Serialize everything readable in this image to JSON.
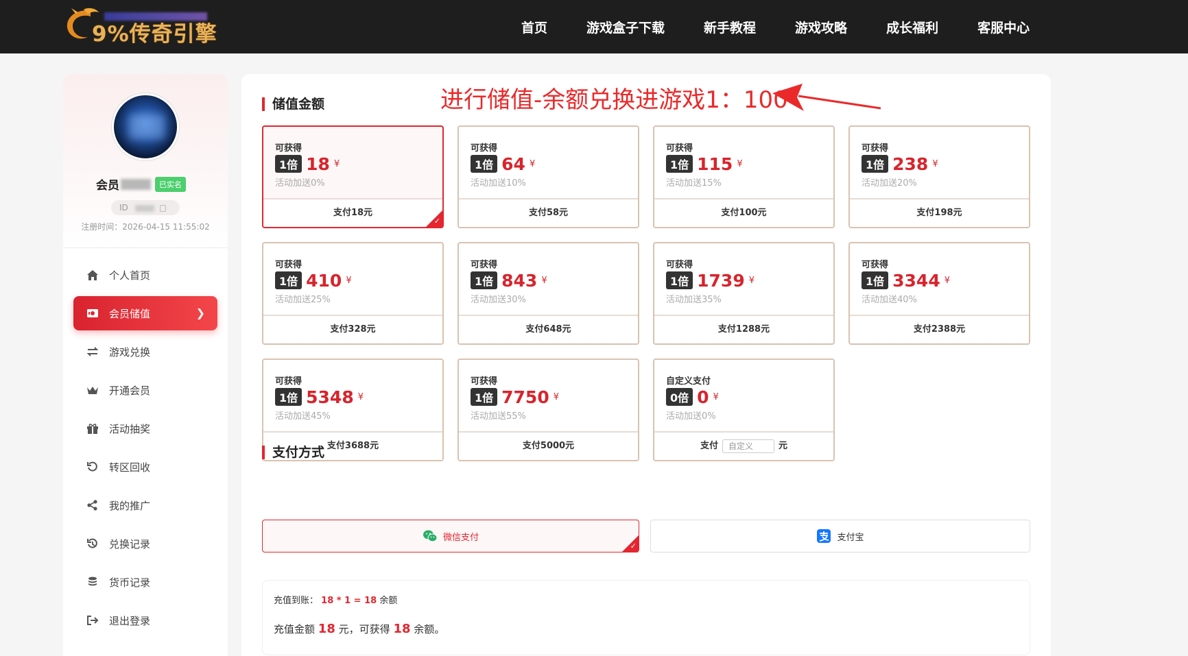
{
  "header": {
    "logo_text": "9%传奇引擎",
    "nav": [
      "首页",
      "游戏盒子下载",
      "新手教程",
      "游戏攻略",
      "成长福利",
      "客服中心"
    ]
  },
  "profile": {
    "name_prefix": "会员",
    "verified_badge": "已实名",
    "id_label": "ID",
    "register_time": "注册时间：2026-04-15 11:55:02"
  },
  "menu": [
    {
      "label": "个人首页",
      "icon": "home-icon"
    },
    {
      "label": "会员储值",
      "icon": "card-icon",
      "active": true
    },
    {
      "label": "游戏兑换",
      "icon": "exchange-icon"
    },
    {
      "label": "开通会员",
      "icon": "crown-icon"
    },
    {
      "label": "活动抽奖",
      "icon": "gift-icon"
    },
    {
      "label": "转区回收",
      "icon": "rotate-icon"
    },
    {
      "label": "我的推广",
      "icon": "share-icon"
    },
    {
      "label": "兑换记录",
      "icon": "history-icon"
    },
    {
      "label": "货币记录",
      "icon": "coins-icon"
    },
    {
      "label": "退出登录",
      "icon": "logout-icon"
    }
  ],
  "recharge": {
    "title": "储值金额",
    "annotation": "进行储值-余额兑换进游戏1：100",
    "cards": [
      {
        "label": "可获得",
        "multiplier": "1倍",
        "amount": "18",
        "bonus": "活动加送0%",
        "pay": "支付18元",
        "selected": true
      },
      {
        "label": "可获得",
        "multiplier": "1倍",
        "amount": "64",
        "bonus": "活动加送10%",
        "pay": "支付58元"
      },
      {
        "label": "可获得",
        "multiplier": "1倍",
        "amount": "115",
        "bonus": "活动加送15%",
        "pay": "支付100元"
      },
      {
        "label": "可获得",
        "multiplier": "1倍",
        "amount": "238",
        "bonus": "活动加送20%",
        "pay": "支付198元"
      },
      {
        "label": "可获得",
        "multiplier": "1倍",
        "amount": "410",
        "bonus": "活动加送25%",
        "pay": "支付328元"
      },
      {
        "label": "可获得",
        "multiplier": "1倍",
        "amount": "843",
        "bonus": "活动加送30%",
        "pay": "支付648元"
      },
      {
        "label": "可获得",
        "multiplier": "1倍",
        "amount": "1739",
        "bonus": "活动加送35%",
        "pay": "支付1288元"
      },
      {
        "label": "可获得",
        "multiplier": "1倍",
        "amount": "3344",
        "bonus": "活动加送40%",
        "pay": "支付2388元"
      },
      {
        "label": "可获得",
        "multiplier": "1倍",
        "amount": "5348",
        "bonus": "活动加送45%",
        "pay": "支付3688元"
      },
      {
        "label": "可获得",
        "multiplier": "1倍",
        "amount": "7750",
        "bonus": "活动加送55%",
        "pay": "支付5000元"
      }
    ],
    "custom": {
      "label": "自定义支付",
      "multiplier": "0倍",
      "amount": "0",
      "bonus": "活动加送0%",
      "pay_prefix": "支付",
      "placeholder": "自定义",
      "pay_suffix": "元"
    },
    "currency_symbol": "¥"
  },
  "payment": {
    "title": "支付方式",
    "methods": [
      {
        "label": "微信支付",
        "icon": "wechat-icon",
        "selected": true
      },
      {
        "label": "支付宝",
        "icon": "alipay-icon"
      }
    ]
  },
  "summary": {
    "line1_prefix": "充值到账：",
    "line1_formula": "18 * 1 = 18",
    "line1_suffix": "余额",
    "line2_prefix": "充值金额",
    "line2_amount": "18",
    "line2_mid": "元，可获得",
    "line2_value": "18",
    "line2_suffix": "余额。"
  },
  "colors": {
    "accent": "#e3262f",
    "header_bg": "#1e1e1e",
    "card_border": "#d9c2b2",
    "logo": "#e8b25a"
  }
}
